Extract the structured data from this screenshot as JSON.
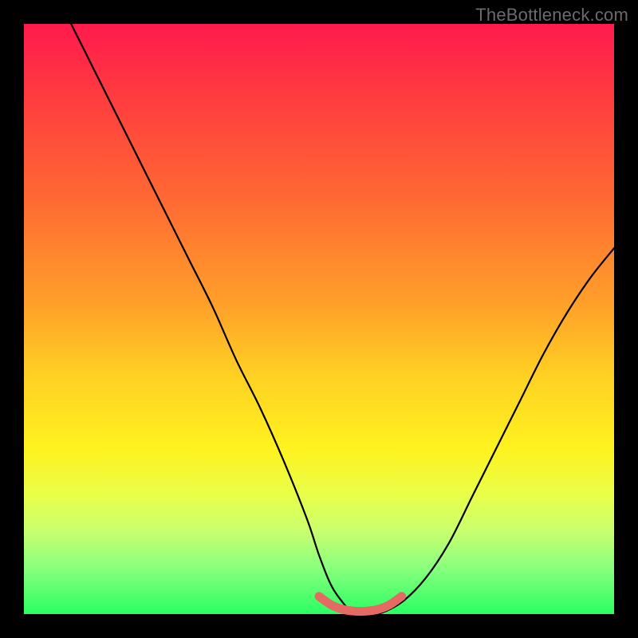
{
  "watermark": "TheBottleneck.com",
  "chart_data": {
    "type": "line",
    "title": "",
    "xlabel": "",
    "ylabel": "",
    "xlim": [
      0,
      100
    ],
    "ylim": [
      0,
      100
    ],
    "series": [
      {
        "name": "bottleneck-curve",
        "x": [
          8,
          12,
          16,
          20,
          24,
          28,
          32,
          36,
          40,
          44,
          48,
          50,
          52,
          54,
          56,
          58,
          60,
          64,
          68,
          72,
          76,
          80,
          84,
          88,
          92,
          96,
          100
        ],
        "values": [
          100,
          92,
          84,
          76,
          68,
          60,
          52,
          43,
          35,
          26,
          16,
          10,
          5,
          2,
          0,
          0,
          0,
          2,
          6,
          12,
          20,
          28,
          36,
          44,
          51,
          57,
          62
        ]
      },
      {
        "name": "sweet-spot-marker",
        "x": [
          50,
          52,
          54,
          56,
          58,
          60,
          62,
          64
        ],
        "values": [
          3.0,
          1.6,
          0.8,
          0.5,
          0.5,
          0.8,
          1.6,
          3.0
        ]
      }
    ],
    "background_gradient": {
      "top": "#ff1a4d",
      "mid_high": "#ffa229",
      "mid": "#fff21f",
      "mid_low": "#c8ff6e",
      "bottom": "#2aff63"
    },
    "annotations": []
  }
}
